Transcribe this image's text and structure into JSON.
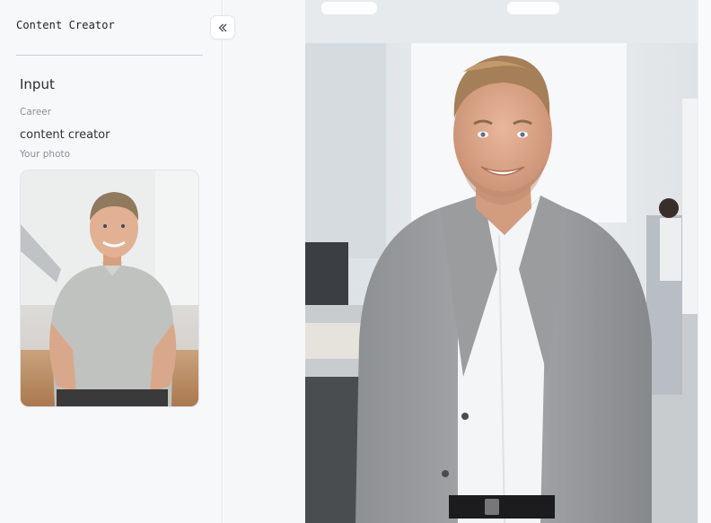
{
  "app": {
    "title": "Content Creator"
  },
  "sidebar": {
    "collapse_icon": "double-chevron-left-icon",
    "section_heading": "Input",
    "career": {
      "label": "Career",
      "value": "content creator"
    },
    "photo": {
      "label": "Your photo"
    }
  },
  "colors": {
    "sidebar_bg": "#f7f8fa",
    "divider": "#c9ccd1",
    "label_gray": "#8b9097"
  }
}
